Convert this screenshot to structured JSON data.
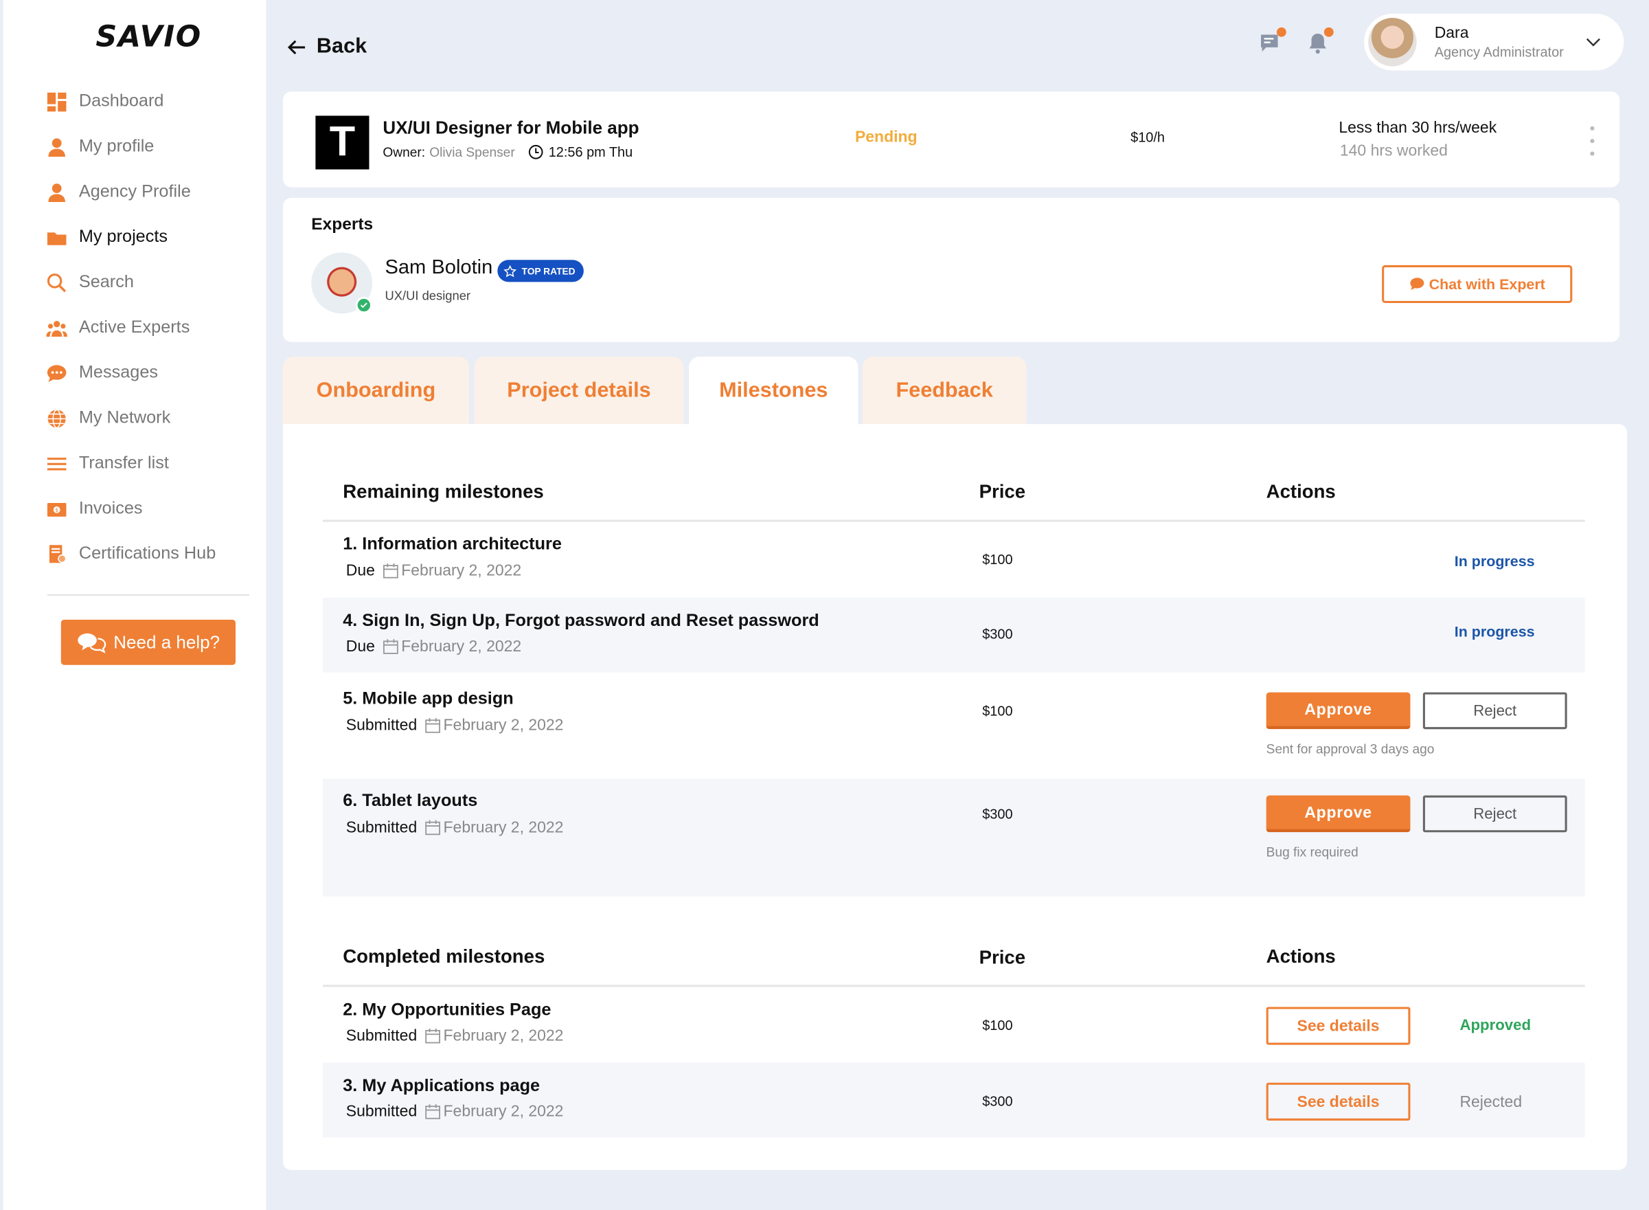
{
  "app": {
    "logo": "SAVIO"
  },
  "sidebar": {
    "items": [
      {
        "label": "Dashboard",
        "icon": "dashboard-icon"
      },
      {
        "label": "My profile",
        "icon": "user-icon"
      },
      {
        "label": "Agency Profile",
        "icon": "user-icon"
      },
      {
        "label": "My projects",
        "icon": "folder-icon",
        "active": true
      },
      {
        "label": "Search",
        "icon": "search-icon"
      },
      {
        "label": "Active Experts",
        "icon": "group-icon"
      },
      {
        "label": "Messages",
        "icon": "chat-bubble-icon"
      },
      {
        "label": "My Network",
        "icon": "globe-icon"
      },
      {
        "label": "Transfer list",
        "icon": "list-icon"
      },
      {
        "label": "Invoices",
        "icon": "invoice-icon"
      },
      {
        "label": "Certifications Hub",
        "icon": "certificate-icon"
      }
    ],
    "help_label": "Need a help?"
  },
  "header": {
    "back_label": "Back",
    "user": {
      "name": "Dara",
      "role": "Agency Administrator"
    }
  },
  "project": {
    "logo_letter": "T",
    "title": "UX/UI Designer for Mobile app",
    "owner_label": "Owner:",
    "owner_name": "Olivia Spenser",
    "time": "12:56 pm Thu",
    "status": "Pending",
    "rate": "$10/h",
    "hours": "Less than 30 hrs/week",
    "worked": "140 hrs worked"
  },
  "experts": {
    "title": "Experts",
    "name": "Sam Bolotin",
    "badge": "TOP RATED",
    "role": "UX/UI designer",
    "chat_label": "Chat with Expert"
  },
  "tabs": [
    "Onboarding",
    "Project details",
    "Milestones",
    "Feedback"
  ],
  "remaining": {
    "headers": {
      "name": "Remaining milestones",
      "price": "Price",
      "actions": "Actions"
    },
    "rows": [
      {
        "title": "1. Information architecture",
        "sub_label": "Due",
        "date": "February 2, 2022",
        "price": "$100",
        "status": "In progress"
      },
      {
        "title": "4. Sign In, Sign Up, Forgot password and Reset password",
        "sub_label": "Due",
        "date": "February 2, 2022",
        "price": "$300",
        "status": "In progress"
      },
      {
        "title": "5. Mobile app design",
        "sub_label": "Submitted",
        "date": "February 2, 2022",
        "price": "$100",
        "approve": "Approve",
        "reject": "Reject",
        "note": "Sent for approval 3 days ago"
      },
      {
        "title": "6. Tablet layouts",
        "sub_label": "Submitted",
        "date": "February 2, 2022",
        "price": "$300",
        "approve": "Approve",
        "reject": "Reject",
        "note": "Bug fix required"
      }
    ]
  },
  "completed": {
    "headers": {
      "name": "Completed milestones",
      "price": "Price",
      "actions": "Actions"
    },
    "rows": [
      {
        "title": "2. My Opportunities Page",
        "sub_label": "Submitted",
        "date": "February 2, 2022",
        "price": "$100",
        "details": "See details",
        "result": "Approved"
      },
      {
        "title": "3. My Applications page",
        "sub_label": "Submitted",
        "date": "February 2, 2022",
        "price": "$300",
        "details": "See details",
        "result": "Rejected"
      }
    ]
  },
  "colors": {
    "accent": "#ef7f34",
    "link_blue": "#1b55a8",
    "approved_green": "#2fa45b",
    "pending_yellow": "#f2ac3b"
  }
}
